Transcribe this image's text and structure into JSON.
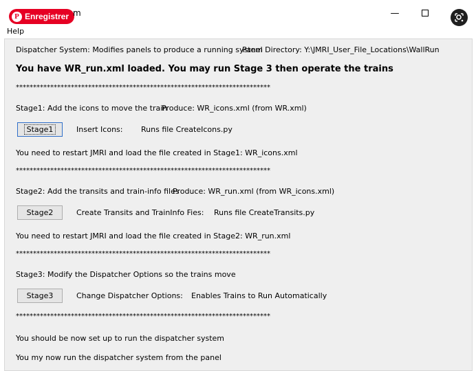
{
  "window": {
    "title": "m",
    "pinterest_label": "Enregistrer",
    "minimize_glyph": "—",
    "close_glyph": "✕"
  },
  "menu": {
    "help": "Help"
  },
  "header": {
    "system_text": "Dispatcher System: Modifies panels to produce a running system",
    "panel_directory": "Panel Directory: Y:\\JMRI_User_File_Locations\\WallRun",
    "loaded_message": "You have WR_run.xml loaded. You may run Stage 3 then operate the trains"
  },
  "separator": "**************************************************************************",
  "stage1": {
    "heading": "Stage1: Add the icons to move the train",
    "produce": "Produce: WR_icons.xml (from WR.xml)",
    "button": "Stage1",
    "action": "Insert Icons:",
    "runs": "Runs file CreateIcons.py",
    "restart": "You need to restart JMRI and load the file created in Stage1: WR_icons.xml"
  },
  "stage2": {
    "heading": "Stage2: Add the transits and train-info files",
    "produce": "Produce: WR_run.xml (from WR_icons.xml)",
    "button": "Stage2",
    "action": "Create Transits and TrainInfo Fies:",
    "runs": "Runs file CreateTransits.py",
    "restart": "You need to restart JMRI and load the file created in Stage2: WR_run.xml"
  },
  "stage3": {
    "heading": "Stage3: Modify the Dispatcher Options so the trains move",
    "button": "Stage3",
    "action": "Change Dispatcher Options:",
    "runs": "Enables Trains to Run Automatically"
  },
  "footer": {
    "line1": "You should be now set up to run the dispatcher system",
    "line2": "You my now run the dispatcher system from the panel"
  }
}
